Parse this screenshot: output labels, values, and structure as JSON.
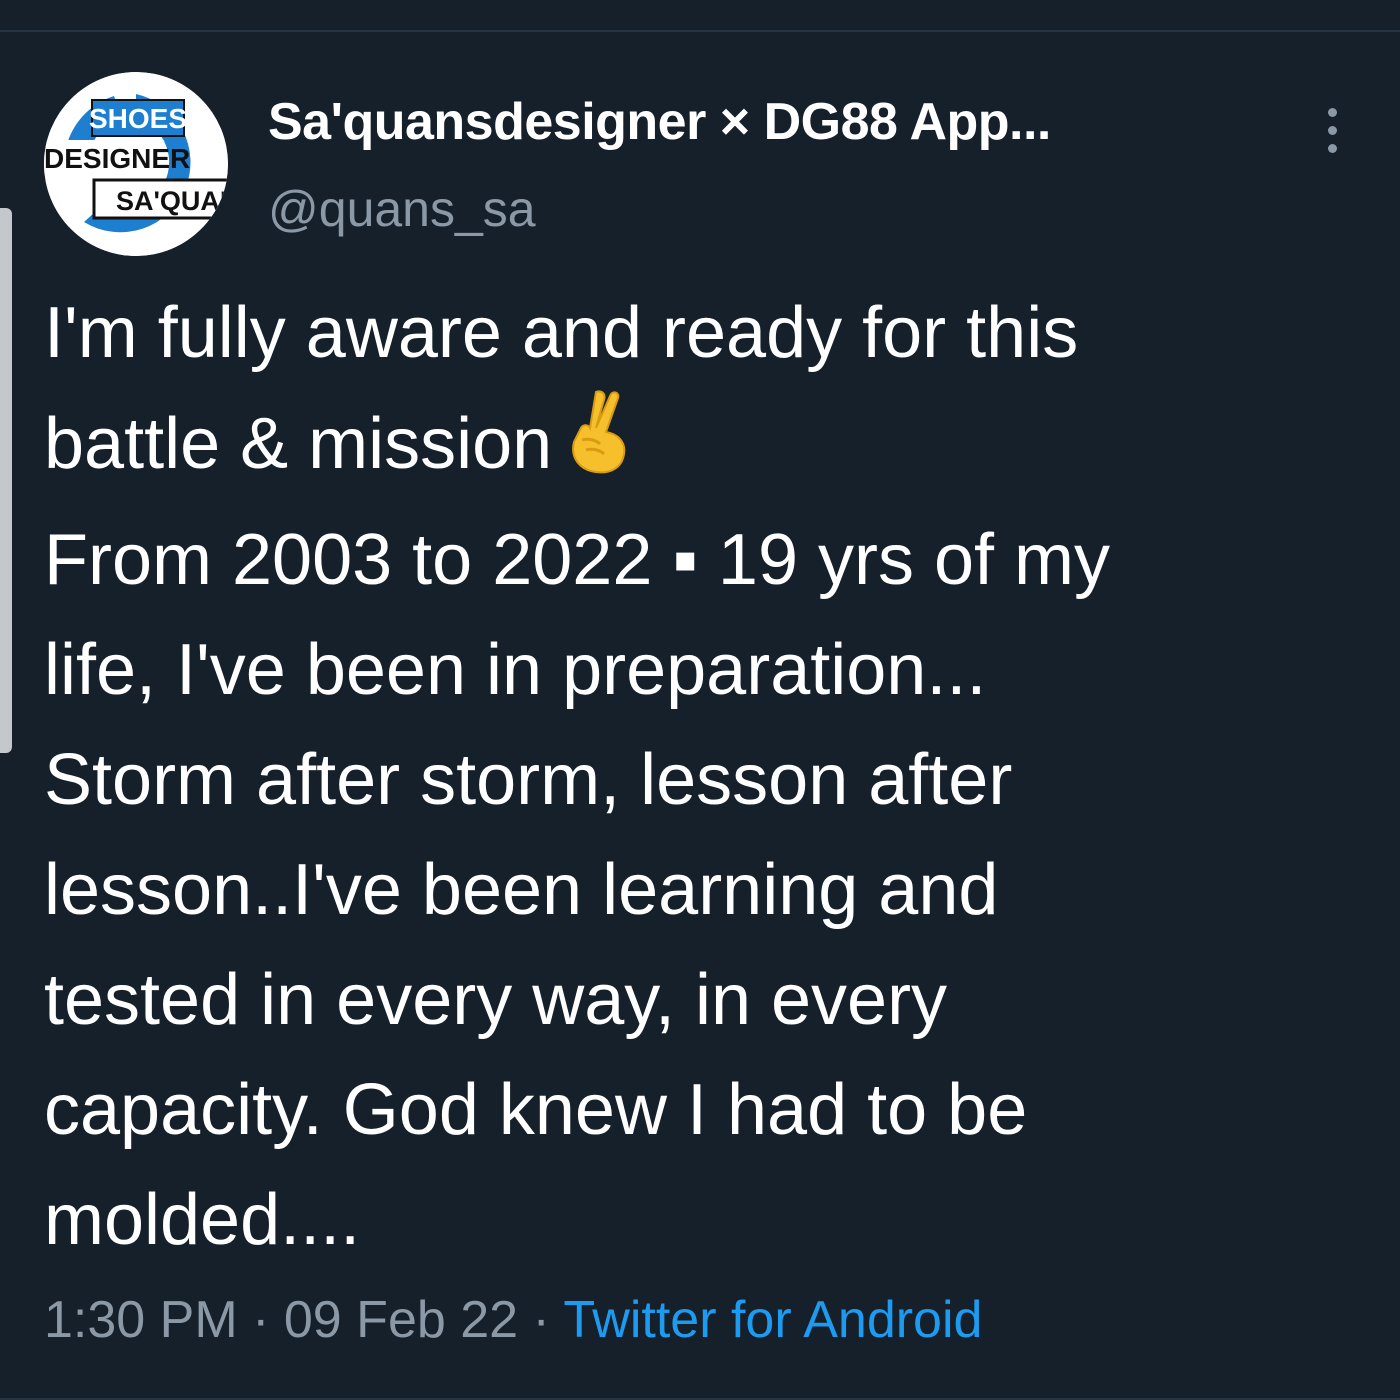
{
  "tweet": {
    "author": {
      "display_name": "Sa'quansdesigner × DG88 App...",
      "handle": "@quans_sa",
      "avatar": {
        "logo_text_top": "SHOES",
        "logo_text_middle": "DESIGNER",
        "logo_text_bottom": "SA'QUAN"
      }
    },
    "more_icon": "vertical-ellipsis-icon",
    "text_lines": [
      "I'm fully aware and ready for this",
      "battle & mission",
      "From 2003 to 2022 ▪ 19 yrs of my",
      "life, I've been in preparation...",
      "Storm after storm, lesson after",
      "lesson..I've been learning and",
      "tested in every way, in every",
      "capacity. God knew I had to be",
      "molded...."
    ],
    "emoji": "crossed-fingers-icon",
    "time": "1:30 PM",
    "separator": "·",
    "date": "09 Feb 22",
    "source": "Twitter for Android"
  },
  "colors": {
    "background": "#15202b",
    "text": "#ffffff",
    "muted": "#8b98a5",
    "link": "#1d9bf0"
  }
}
